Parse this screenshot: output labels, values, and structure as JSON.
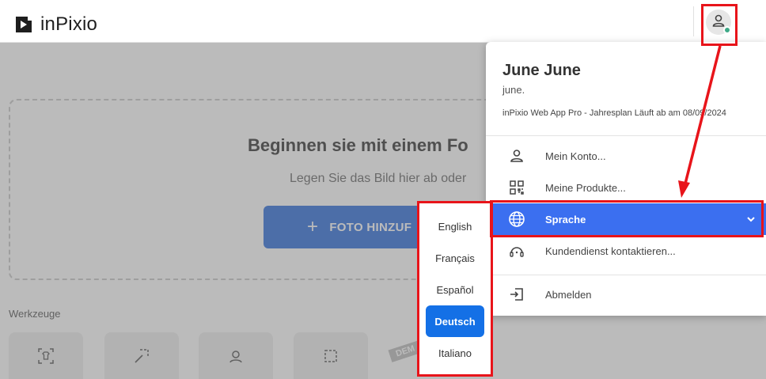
{
  "header": {
    "logo_text": "inPixio"
  },
  "main": {
    "drop_title": "Beginnen sie mit einem Fo",
    "drop_subtitle": "Legen Sie das Bild hier ab oder",
    "add_button_label": "FOTO HINZUF",
    "tools_label": "Werkzeuge",
    "demo_badge": "DEM"
  },
  "account": {
    "name": "June June",
    "email": "june.",
    "plan": "inPixio Web App Pro - Jahresplan Läuft ab am 08/09/2024",
    "menu": [
      {
        "label": "Mein Konto...",
        "icon": "person-icon"
      },
      {
        "label": "Meine Produkte...",
        "icon": "qr-products-icon"
      },
      {
        "label": "Sprache",
        "icon": "globe-icon"
      },
      {
        "label": "Kundendienst kontaktieren...",
        "icon": "support-icon"
      },
      {
        "label": "Abmelden",
        "icon": "logout-icon"
      }
    ]
  },
  "language": {
    "options": [
      "English",
      "Français",
      "Español",
      "Deutsch",
      "Italiano"
    ],
    "selected": "Deutsch"
  },
  "colors": {
    "accent": "#3b6ff0",
    "selected_lang": "#1470e6",
    "highlight": "#e8141a",
    "status_online": "#3ea987"
  }
}
